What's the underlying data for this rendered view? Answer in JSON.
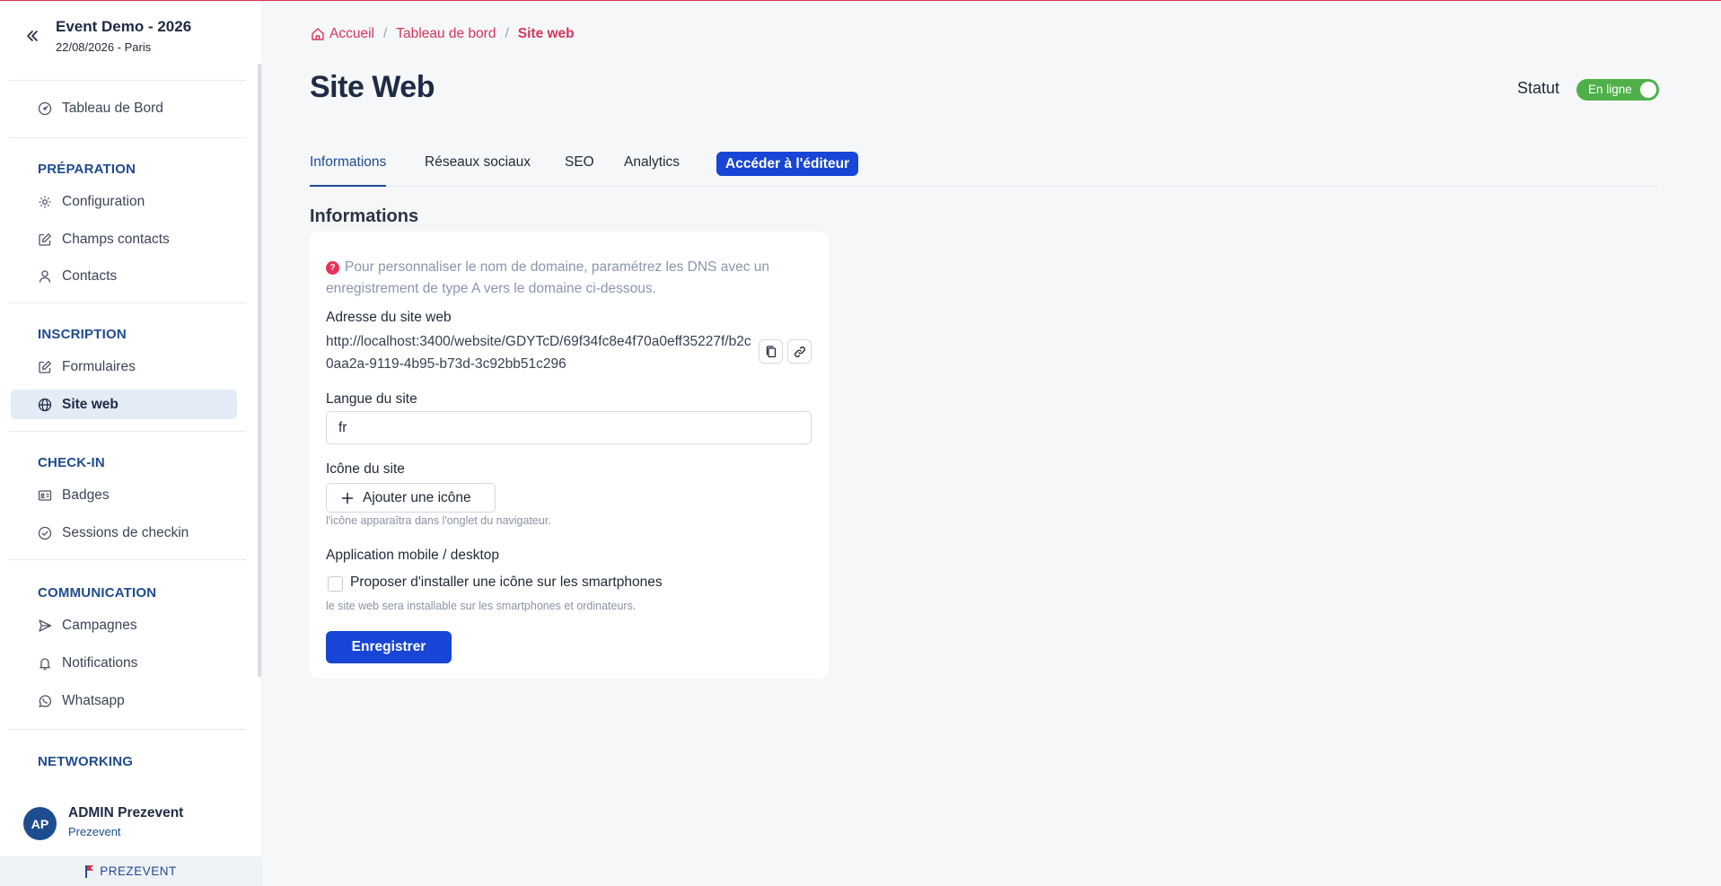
{
  "event": {
    "title": "Event Demo - 2026",
    "subtitle": "22/08/2026 - Paris"
  },
  "sidebar": {
    "dashboard": "Tableau de Bord",
    "sections": {
      "preparation": "PRÉPARATION",
      "inscription": "INSCRIPTION",
      "checkin": "CHECK-IN",
      "communication": "COMMUNICATION",
      "networking": "NETWORKING"
    },
    "items": {
      "configuration": "Configuration",
      "champs_contacts": "Champs contacts",
      "contacts": "Contacts",
      "formulaires": "Formulaires",
      "site_web": "Site web",
      "badges": "Badges",
      "sessions": "Sessions de checkin",
      "campagnes": "Campagnes",
      "notifications": "Notifications",
      "whatsapp": "Whatsapp"
    },
    "active_item": "site_web"
  },
  "user": {
    "initials": "AP",
    "name": "ADMIN Prezevent",
    "org": "Prezevent"
  },
  "brand": "PREZEVENT",
  "breadcrumb": {
    "home": "Accueil",
    "dashboard": "Tableau de bord",
    "current": "Site web"
  },
  "page": {
    "title": "Site Web",
    "status_label": "Statut",
    "status_value": "En ligne",
    "status_on": true
  },
  "tabs": {
    "informations": "Informations",
    "reseaux": "Réseaux sociaux",
    "seo": "SEO",
    "analytics": "Analytics",
    "editor_button": "Accéder à l'éditeur"
  },
  "form": {
    "section_title": "Informations",
    "notice": "Pour personnaliser le nom de domaine, paramétrez les DNS avec un enregistrement de type A vers le domaine ci-dessous.",
    "address_label": "Adresse du site web",
    "address_value": "http://localhost:3400/website/GDYTcD/69f34fc8e4f70a0eff35227f/b2c0aa2a-9119-4b95-b73d-3c92bb51c296",
    "language_label": "Langue du site",
    "language_value": "fr",
    "icon_label": "Icône du site",
    "add_icon_button": "Ajouter une icône",
    "icon_hint": "l'icône apparaîtra dans l'onglet du navigateur.",
    "mobile_label": "Application mobile / desktop",
    "mobile_checkbox": "Proposer d'installer une icône sur les smartphones",
    "mobile_checked": false,
    "mobile_hint": "le site web sera installable sur les smartphones et ordinateurs.",
    "save_button": "Enregistrer"
  },
  "colors": {
    "accent": "#1746d6",
    "brand_red": "#d4365c",
    "navy": "#1f4b8e",
    "online_green": "#4fb04a"
  }
}
